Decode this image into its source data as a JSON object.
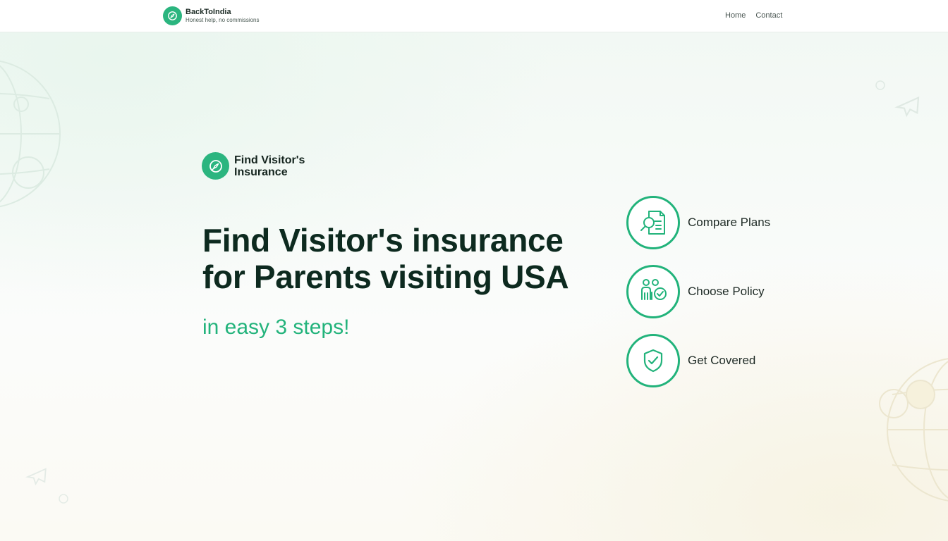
{
  "header": {
    "brand_name": "BackToIndia",
    "brand_tagline": "Honest help, no commissions",
    "logo_icon": "compass-icon",
    "nav": [
      {
        "label": "Home"
      },
      {
        "label": "Contact"
      }
    ]
  },
  "hero": {
    "badge_text": "Find Visitor's Insurance",
    "badge_icon": "compass-icon",
    "title": "Find Visitor's insurance for Parents visiting USA",
    "subtitle": "in easy 3 steps!"
  },
  "steps": [
    {
      "label": "Compare Plans",
      "icon": "magnifier-document-icon"
    },
    {
      "label": "Choose Policy",
      "icon": "family-check-icon"
    },
    {
      "label": "Get Covered",
      "icon": "shield-check-icon"
    }
  ],
  "colors": {
    "accent": "#22b37b",
    "brand_green": "#2bb57f",
    "heading": "#0d2a1f"
  }
}
